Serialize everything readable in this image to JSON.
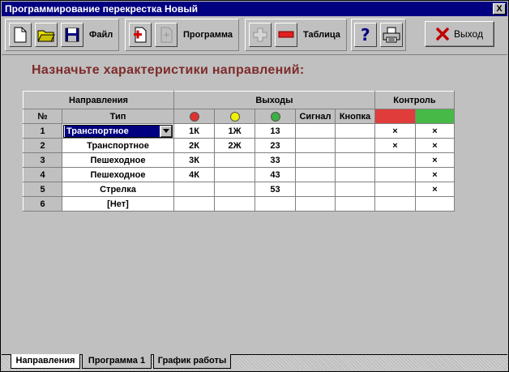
{
  "window": {
    "title": "Программирование перекрестка Новый",
    "close_label": "X"
  },
  "toolbar": {
    "file_label": "Файл",
    "program_label": "Программа",
    "table_label": "Таблица",
    "exit_label": "Выход"
  },
  "heading": "Назначьте характеристики направлений:",
  "table": {
    "group_headers": {
      "directions": "Направления",
      "outputs": "Выходы",
      "control": "Контроль"
    },
    "columns": {
      "num": "№",
      "type": "Тип",
      "signal": "Сигнал",
      "button": "Кнопка"
    },
    "colors": {
      "red": "#e03030",
      "yellow": "#f0f000",
      "green": "#3cb043",
      "control_red": "#e03c3c",
      "control_green": "#46b946"
    },
    "rows": [
      {
        "num": "1",
        "type": "Транспортное",
        "red": "1К",
        "yellow": "1Ж",
        "green": "13",
        "signal": "",
        "button": "",
        "ctrl_red": "×",
        "ctrl_green": "×"
      },
      {
        "num": "2",
        "type": "Транспортное",
        "red": "2К",
        "yellow": "2Ж",
        "green": "23",
        "signal": "",
        "button": "",
        "ctrl_red": "×",
        "ctrl_green": "×"
      },
      {
        "num": "3",
        "type": "Пешеходное",
        "red": "3К",
        "yellow": "",
        "green": "33",
        "signal": "",
        "button": "",
        "ctrl_red": "",
        "ctrl_green": "×"
      },
      {
        "num": "4",
        "type": "Пешеходное",
        "red": "4К",
        "yellow": "",
        "green": "43",
        "signal": "",
        "button": "",
        "ctrl_red": "",
        "ctrl_green": "×"
      },
      {
        "num": "5",
        "type": "Стрелка",
        "red": "",
        "yellow": "",
        "green": "53",
        "signal": "",
        "button": "",
        "ctrl_red": "",
        "ctrl_green": "×"
      },
      {
        "num": "6",
        "type": "[Нет]",
        "red": "",
        "yellow": "",
        "green": "",
        "signal": "",
        "button": "",
        "ctrl_red": "",
        "ctrl_green": ""
      }
    ]
  },
  "tabs": [
    {
      "label": "Направления",
      "active": true
    },
    {
      "label": "Программа 1",
      "active": false
    },
    {
      "label": "График работы",
      "active": false
    }
  ]
}
